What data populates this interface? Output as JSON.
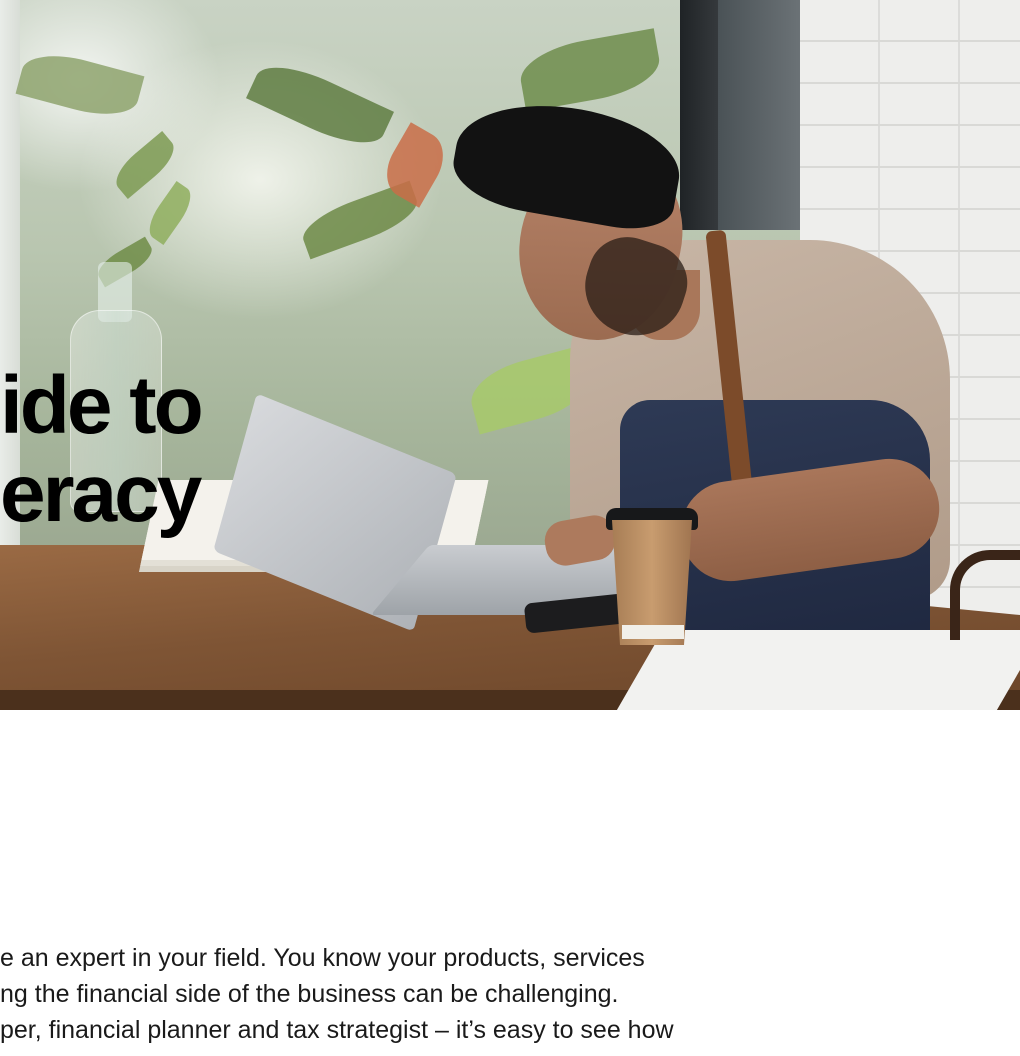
{
  "hero": {
    "image_description_icon": "photo-man-laptop-coffee"
  },
  "headline": {
    "line1": "ide to",
    "line2": "eracy"
  },
  "body": {
    "line1": "e an expert in your field. You know your products, services",
    "line2": "ng the financial side of the business can be challenging.",
    "line3": "per, financial planner and tax strategist – it’s easy to see how"
  },
  "colors": {
    "headline": "#000000",
    "body": "#1a1a1a",
    "background": "#ffffff"
  }
}
